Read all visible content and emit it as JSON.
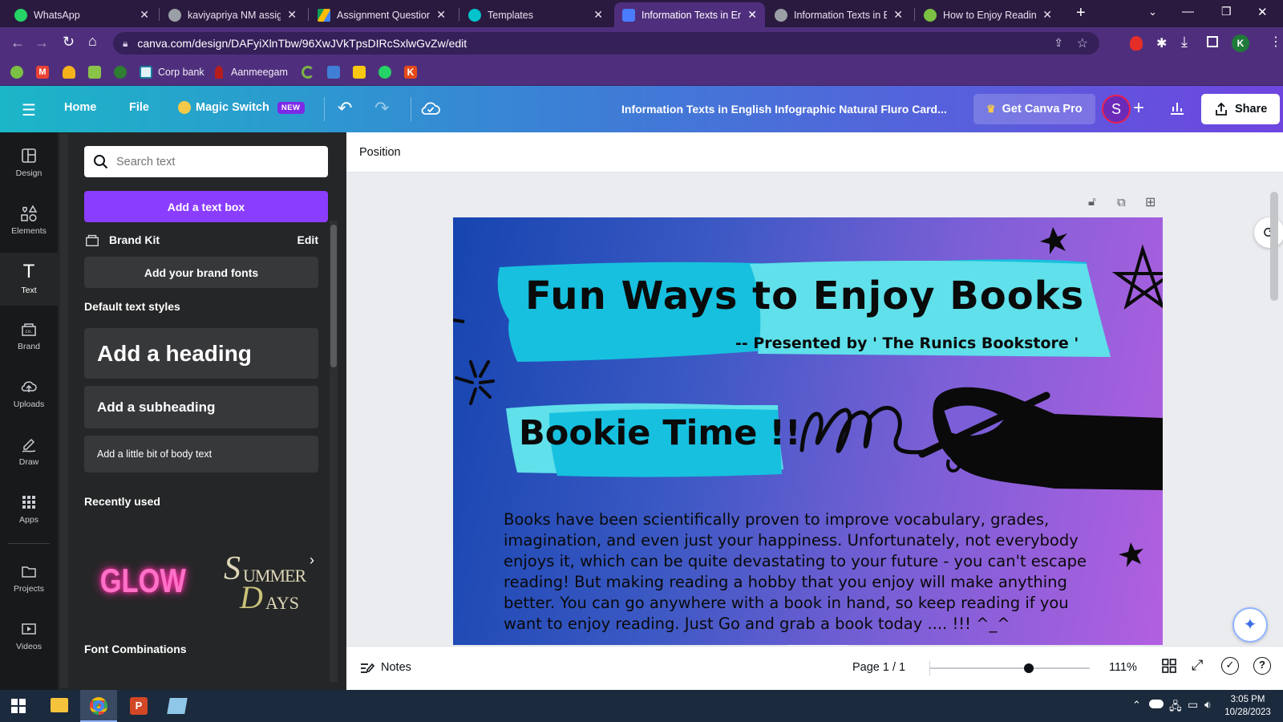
{
  "browser": {
    "tabs": [
      {
        "title": "WhatsApp",
        "icon": "whatsapp-icon",
        "color": "#25d366"
      },
      {
        "title": "kaviyapriya NM assign",
        "icon": "globe-icon",
        "color": "#9aa0a6"
      },
      {
        "title": "Assignment Questions",
        "icon": "drive-icon",
        "color": "#fbbc04"
      },
      {
        "title": "Templates",
        "icon": "canva-icon",
        "color": "#00c4cc"
      },
      {
        "title": "Information Texts in En",
        "icon": "canva-doc-icon",
        "color": "#4a7cff"
      },
      {
        "title": "Information Texts in En",
        "icon": "globe-icon",
        "color": "#9aa0a6"
      },
      {
        "title": "How to Enjoy Reading",
        "icon": "page-icon",
        "color": "#7bc043"
      }
    ],
    "url": "canva.com/design/DAFyiXlnTbw/96XwJVkTpsDIRcSxlwGvZw/edit",
    "profile_initial": "K",
    "bookmarks": [
      {
        "label": "",
        "icon": "bookmark-green-icon"
      },
      {
        "label": "",
        "icon": "gmail-icon"
      },
      {
        "label": "",
        "icon": "crown-icon"
      },
      {
        "label": "",
        "icon": "leaf-icon"
      },
      {
        "label": "",
        "icon": "dragon-icon"
      },
      {
        "label": "Corp bank",
        "icon": "bank-icon"
      },
      {
        "label": "Aanmeegam",
        "icon": "lamp-icon"
      },
      {
        "label": "",
        "icon": "moon-icon"
      },
      {
        "label": "",
        "icon": "star-app-icon"
      },
      {
        "label": "",
        "icon": "photo-icon"
      },
      {
        "label": "",
        "icon": "whatsapp-icon"
      },
      {
        "label": "",
        "icon": "k-app-icon"
      }
    ]
  },
  "canva": {
    "home": "Home",
    "file": "File",
    "magic_switch": "Magic Switch",
    "new_badge": "NEW",
    "design_title": "Information Texts in English Infographic Natural Fluro Card...",
    "get_pro": "Get Canva Pro",
    "avatar_initial": "S",
    "share": "Share",
    "position": "Position"
  },
  "rail": [
    {
      "label": "Design",
      "icon": "design-icon"
    },
    {
      "label": "Elements",
      "icon": "elements-icon"
    },
    {
      "label": "Text",
      "icon": "text-icon",
      "active": true
    },
    {
      "label": "Brand",
      "icon": "brand-icon"
    },
    {
      "label": "Uploads",
      "icon": "upload-icon"
    },
    {
      "label": "Draw",
      "icon": "draw-icon"
    },
    {
      "label": "Apps",
      "icon": "apps-icon"
    },
    {
      "label": "Projects",
      "icon": "folder-icon"
    },
    {
      "label": "Videos",
      "icon": "video-icon"
    }
  ],
  "panel": {
    "search_placeholder": "Search text",
    "add_text_box": "Add a text box",
    "brand_kit": "Brand Kit",
    "edit": "Edit",
    "add_brand_fonts": "Add your brand fonts",
    "default_styles": "Default text styles",
    "heading": "Add a heading",
    "subheading": "Add a subheading",
    "body": "Add a little bit of body text",
    "recently_used": "Recently used",
    "glow": "GLOW",
    "summer_1": "UMMER",
    "summer_s": "S",
    "days_d": "D",
    "days": "AYS",
    "font_combinations": "Font Combinations"
  },
  "design": {
    "title": "Fun Ways to Enjoy Books",
    "subtitle": "-- Presented by ' The Runics Bookstore '",
    "bookie": "Bookie Time !!",
    "body_lines": [
      "Books have been scientifically proven to improve vocabulary, grades,",
      "imagination, and even just your happiness. Unfortunately, not everybody",
      "enjoys it, which can be quite devastating to your future - you can't escape",
      "reading! But making reading a hobby that you enjoy will make anything",
      "better. You can go anywhere with a book in hand, so keep reading if you",
      "want to enjoy reading.  Just Go and grab a book today .... !!! ^_^"
    ]
  },
  "footer": {
    "notes": "Notes",
    "page": "Page 1 / 1",
    "zoom": "111%",
    "zoom_fraction": 0.62
  },
  "taskbar": {
    "time": "3:05 PM",
    "date": "10/28/2023"
  }
}
